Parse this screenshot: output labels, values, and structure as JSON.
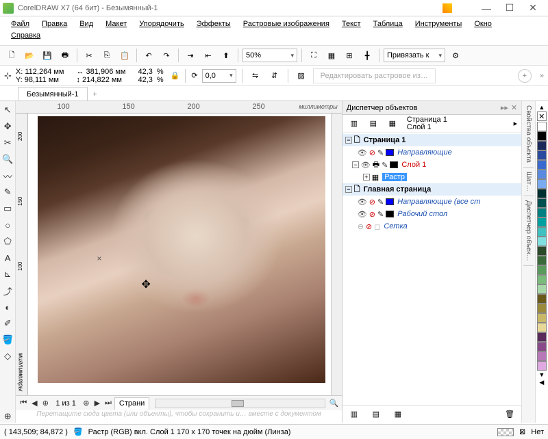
{
  "title": "CorelDRAW X7 (64 бит) - Безымянный-1",
  "menu": [
    "Файл",
    "Правка",
    "Вид",
    "Макет",
    "Упорядочить",
    "Эффекты",
    "Растровые изображения",
    "Текст",
    "Таблица",
    "Инструменты",
    "Окно",
    "Справка"
  ],
  "toolbar": {
    "zoom": "50%",
    "snap": "Привязать к"
  },
  "props": {
    "x": "X: 112,264 мм",
    "y": "Y: 98,111 мм",
    "w_icon": "↔",
    "w": "381,906 мм",
    "h_icon": "↕",
    "h": "214,822 мм",
    "sx": "42,3",
    "sy": "42,3",
    "pct": "%",
    "rot": "0,0",
    "editbmp": "Редактировать растровое из…"
  },
  "doc_tab": "Безымянный-1",
  "ruler": {
    "h": [
      "100",
      "150",
      "200",
      "250"
    ],
    "unit": "миллиметры",
    "v": [
      "200",
      "150",
      "100"
    ]
  },
  "nav": {
    "page": "1 из 1",
    "pagetab": "Страни"
  },
  "hint": "Перетащите сюда цвета (или объекты), чтобы сохранить и… вместе с документом",
  "objmgr": {
    "title": "Диспетчер объектов",
    "cur_page": "Страница 1",
    "cur_layer": "Слой 1",
    "tree": {
      "page1": "Страница 1",
      "guides": "Направляющие",
      "layer1": "Слой 1",
      "raster": "Растр",
      "master": "Главная страница",
      "guides_all": "Направляющие (все ст",
      "desktop": "Рабочий стол",
      "grid": "Сетка"
    }
  },
  "sidetabs": [
    "Свойства объекта",
    "Шат…",
    "Диспетчер объек…"
  ],
  "palette": [
    "#ffffff",
    "#000000",
    "#1a2a5a",
    "#2a4aa0",
    "#3a6ad0",
    "#5a8ae0",
    "#7aaaf0",
    "#003030",
    "#005050",
    "#008080",
    "#00a0a0",
    "#40c0c0",
    "#80e0e0",
    "#2a4a2a",
    "#3a6a3a",
    "#5a9a5a",
    "#7aba7a",
    "#a8d8a8",
    "#6a5a1a",
    "#9a8a3a",
    "#c8b868",
    "#e8d898",
    "#5a2a5a",
    "#8a4a8a",
    "#b878b8",
    "#e0a8e0"
  ],
  "status": {
    "coords": "( 143,509; 84,872 )",
    "info": "Растр (RGB) вкл. Слой 1 170 x 170 точек на дюйм  (Линза)",
    "fill_none": "⊠",
    "outline_none": "Нет"
  }
}
